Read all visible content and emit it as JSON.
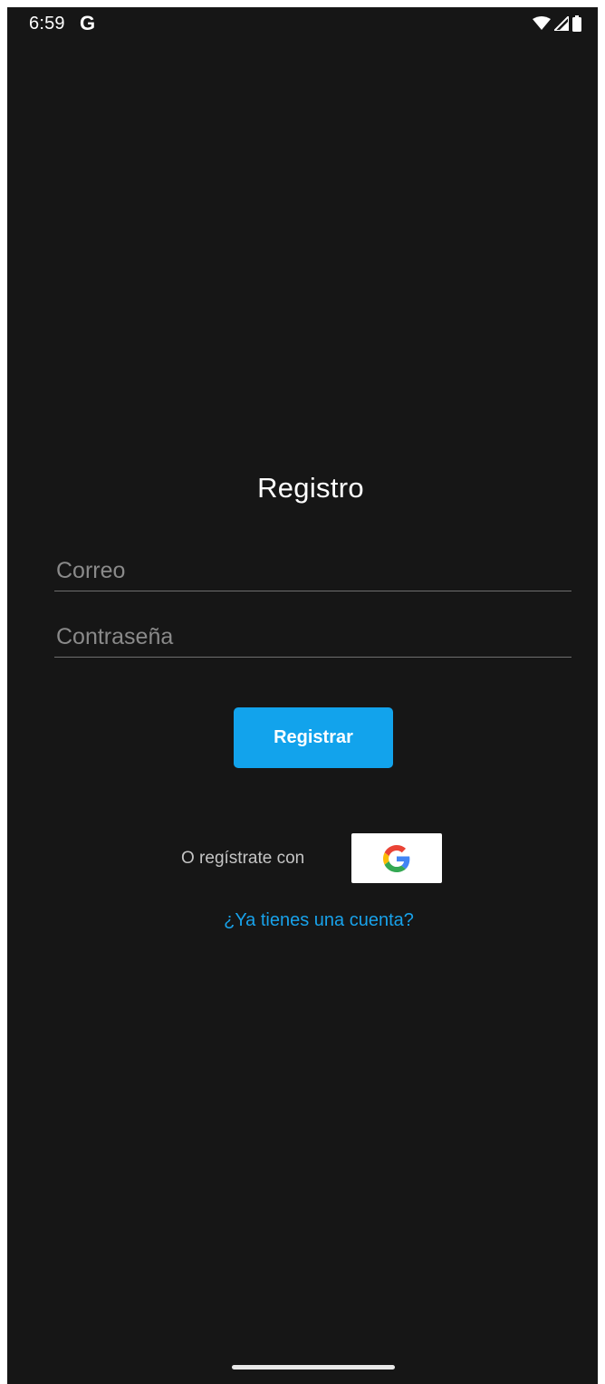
{
  "status_bar": {
    "time": "6:59",
    "notification_icon": "google-g-icon",
    "icons": [
      "wifi-icon",
      "signal-icon",
      "battery-icon"
    ]
  },
  "page": {
    "title": "Registro"
  },
  "form": {
    "email_placeholder": "Correo",
    "password_placeholder": "Contraseña",
    "register_label": "Registrar"
  },
  "social": {
    "prompt": "O regístrate con",
    "google_icon": "google-logo-icon"
  },
  "footer_link": {
    "label": "¿Ya tienes una cuenta?"
  },
  "colors": {
    "background": "#161616",
    "accent": "#12a3ec",
    "link": "#18a2ea",
    "text": "#ffffff",
    "muted_text": "#c4c4c4"
  }
}
